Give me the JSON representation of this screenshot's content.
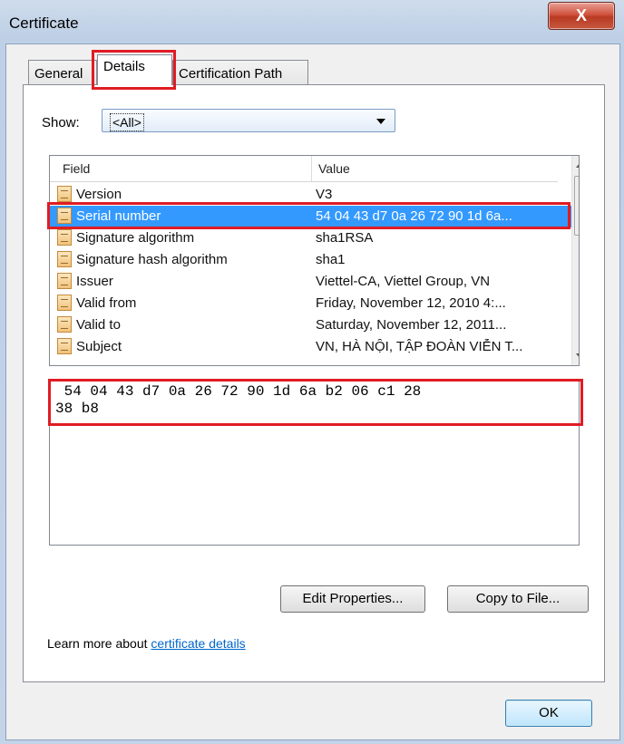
{
  "window": {
    "title": "Certificate",
    "close_label": "X"
  },
  "tabs": [
    {
      "label": "General",
      "active": false
    },
    {
      "label": "Details",
      "active": true
    },
    {
      "label": "Certification Path",
      "active": false
    }
  ],
  "show": {
    "label": "Show:",
    "selected": "<All>"
  },
  "list": {
    "columns": [
      "Field",
      "Value"
    ],
    "rows": [
      {
        "field": "Version",
        "value": "V3",
        "selected": false
      },
      {
        "field": "Serial number",
        "value": "54 04 43 d7 0a 26 72 90 1d 6a...",
        "selected": true
      },
      {
        "field": "Signature algorithm",
        "value": "sha1RSA",
        "selected": false
      },
      {
        "field": "Signature hash algorithm",
        "value": "sha1",
        "selected": false
      },
      {
        "field": "Issuer",
        "value": "Viettel-CA, Viettel Group, VN",
        "selected": false
      },
      {
        "field": "Valid from",
        "value": "Friday, November 12, 2010 4:...",
        "selected": false
      },
      {
        "field": "Valid to",
        "value": "Saturday, November 12, 2011...",
        "selected": false
      },
      {
        "field": "Subject",
        "value": "VN, HÀ NỘI, TẬP ĐOÀN VIỄN T...",
        "selected": false
      }
    ]
  },
  "value_box": {
    "line1": " 54 04 43 d7 0a 26 72 90 1d 6a b2 06 c1 28",
    "line2": "38 b8"
  },
  "buttons": {
    "edit": "Edit Properties...",
    "copy": "Copy to File...",
    "ok": "OK"
  },
  "learn": {
    "prefix": "Learn more about ",
    "link": "certificate details"
  },
  "colors": {
    "highlight": "#e01c24",
    "selection": "#3399ff",
    "link": "#0066cc"
  }
}
